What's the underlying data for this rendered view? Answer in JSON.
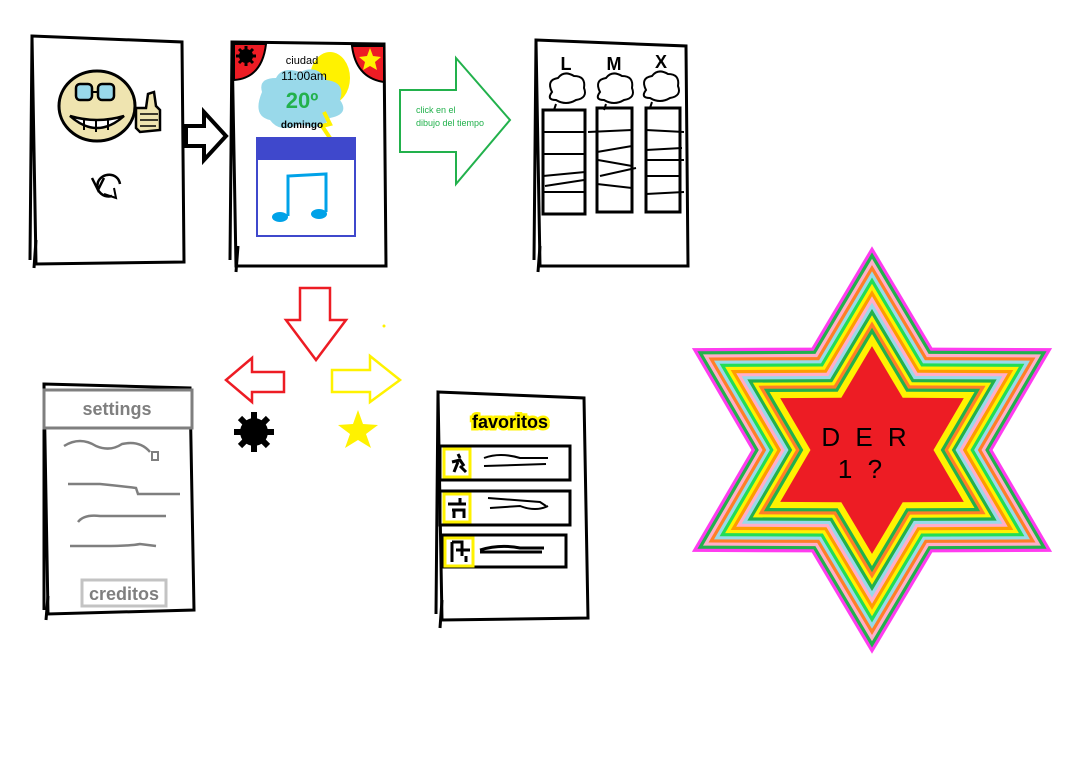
{
  "weather_screen": {
    "city": "ciudad",
    "time": "11:00am",
    "temperature": "20º",
    "day": "domingo"
  },
  "arrow_note": {
    "line1": "click en el",
    "line2": "dibujo del tiempo"
  },
  "forecast_screen": {
    "days": [
      "L",
      "M",
      "X"
    ]
  },
  "settings_screen": {
    "title": "settings",
    "credits_button": "creditos"
  },
  "favorites_screen": {
    "title": "favoritos"
  },
  "star_badge": {
    "line1": "D E R",
    "line2": "1 ?"
  },
  "colors": {
    "outline": "#000000",
    "green_arrow": "#22b14c",
    "red_arrow": "#ed1c24",
    "yellow_arrow": "#fff200",
    "music_blue": "#00a2e8",
    "player_bar": "#3f48cc",
    "face": "#efe4b0"
  },
  "icons": [
    "refresh-icon",
    "gear-icon",
    "star-icon",
    "music-note-icon",
    "thumbs-up-icon",
    "weather-icon"
  ]
}
